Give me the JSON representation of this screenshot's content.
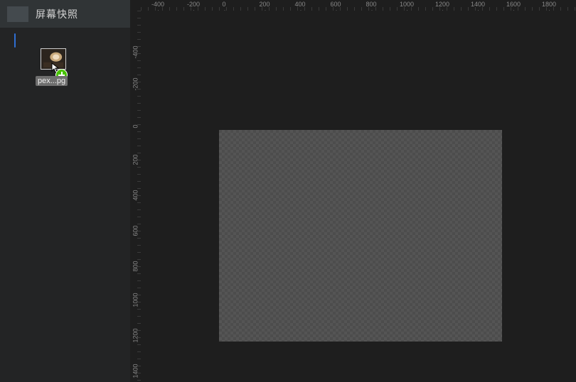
{
  "panel": {
    "title": "屏幕快照"
  },
  "drag": {
    "filename": "pex...pg"
  },
  "ruler": {
    "top": [
      "-400",
      "-200",
      "0",
      "200",
      "400",
      "600",
      "800",
      "1000",
      "1200",
      "1400",
      "1600",
      "1800"
    ],
    "left": [
      "-400",
      "-200",
      "0",
      "200",
      "400",
      "600",
      "800",
      "1000",
      "1200",
      "1400"
    ]
  }
}
